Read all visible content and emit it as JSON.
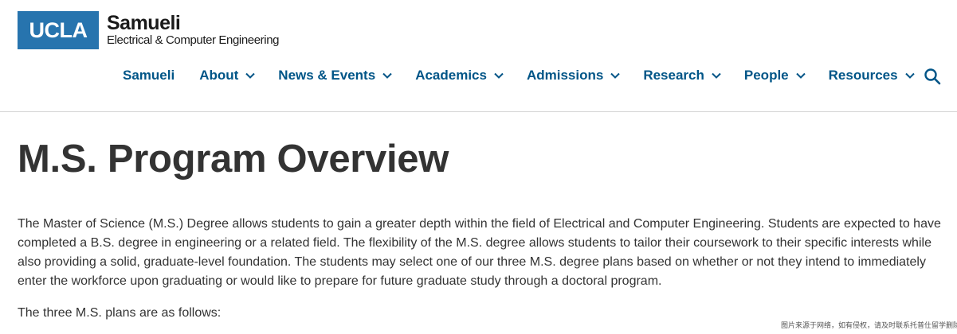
{
  "header": {
    "logo_box": "UCLA",
    "logo_title": "Samueli",
    "logo_subtitle": "Electrical & Computer Engineering"
  },
  "nav": {
    "items": [
      {
        "label": "Samueli",
        "has_dropdown": false
      },
      {
        "label": "About",
        "has_dropdown": true
      },
      {
        "label": "News & Events",
        "has_dropdown": true
      },
      {
        "label": "Academics",
        "has_dropdown": true
      },
      {
        "label": "Admissions",
        "has_dropdown": true
      },
      {
        "label": "Research",
        "has_dropdown": true
      },
      {
        "label": "People",
        "has_dropdown": true
      },
      {
        "label": "Resources",
        "has_dropdown": true
      }
    ],
    "search_icon": "search-icon"
  },
  "main": {
    "title": "M.S. Program Overview",
    "intro": "The Master of Science (M.S.) Degree allows students to gain a greater depth within the field of Electrical and Computer Engineering.  Students are expected to have completed a B.S. degree in engineering or a related field.  The flexibility of the M.S. degree allows students to tailor their coursework to their specific interests while also providing a solid, graduate-level foundation.  The students may select one of our three M.S. degree plans based on whether or not they intend to immediately enter the workforce upon graduating or would like to prepare for future graduate study through a doctoral program.",
    "plans_intro": "The three M.S. plans are as follows:"
  },
  "watermark": "图片来源于网络，如有侵权，请及时联系托普仕留学删除",
  "colors": {
    "brand_blue": "#2774ae",
    "nav_text": "#005587",
    "body_text": "#333333"
  }
}
